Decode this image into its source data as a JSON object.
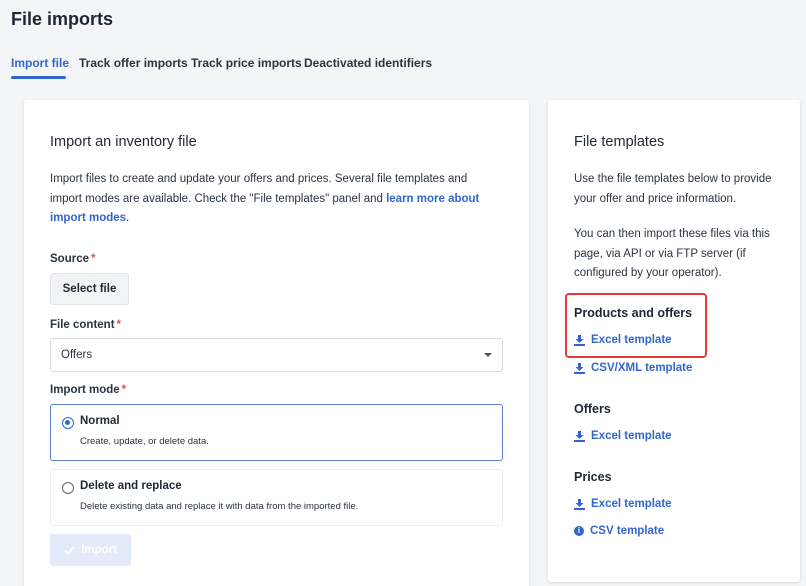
{
  "page": {
    "title": "File imports"
  },
  "tabs": [
    {
      "label": "Import file",
      "active": true
    },
    {
      "label": "Track offer imports",
      "active": false
    },
    {
      "label": "Track price imports",
      "active": false
    },
    {
      "label": "Deactivated identifiers",
      "active": false
    }
  ],
  "main": {
    "title": "Import an inventory file",
    "intro_line1": "Import files to create and update your offers and prices. Several file templates and",
    "intro_line2_prefix": "import modes are available. Check the \"File templates\" panel and ",
    "intro_link_a": "learn more about",
    "intro_link_b": "import modes",
    "intro_suffix": ".",
    "required_mark": "*",
    "source_label": "Source",
    "select_file_button": "Select file",
    "file_content_label": "File content",
    "file_content_value": "Offers",
    "import_mode_label": "Import mode",
    "modes": [
      {
        "title": "Normal",
        "description": "Create, update, or delete data.",
        "selected": true
      },
      {
        "title": "Delete and replace",
        "description": "Delete existing data and replace it with data from the imported file.",
        "selected": false
      }
    ],
    "import_button": "Import"
  },
  "side": {
    "title": "File templates",
    "para1_line1": "Use the file templates below to provide",
    "para1_line2": "your offer and price information.",
    "para2_line1": "You can then import these files via this",
    "para2_line2": "page, via API or via FTP server (if",
    "para2_line3": "configured by your operator).",
    "sections": {
      "products_offers": {
        "heading": "Products and offers",
        "links": [
          "Excel template",
          "CSV/XML template"
        ]
      },
      "offers": {
        "heading": "Offers",
        "links": [
          "Excel template"
        ]
      },
      "prices": {
        "heading": "Prices",
        "links": [
          "Excel template",
          "CSV template"
        ]
      }
    }
  },
  "colors": {
    "accent": "#3366cc",
    "required": "#d9534f",
    "highlight": "#e53935",
    "background": "#f4f5f7"
  },
  "icons": {
    "download": "download-icon",
    "info": "info-icon",
    "check": "check-icon",
    "caret": "chevron-down-icon"
  }
}
